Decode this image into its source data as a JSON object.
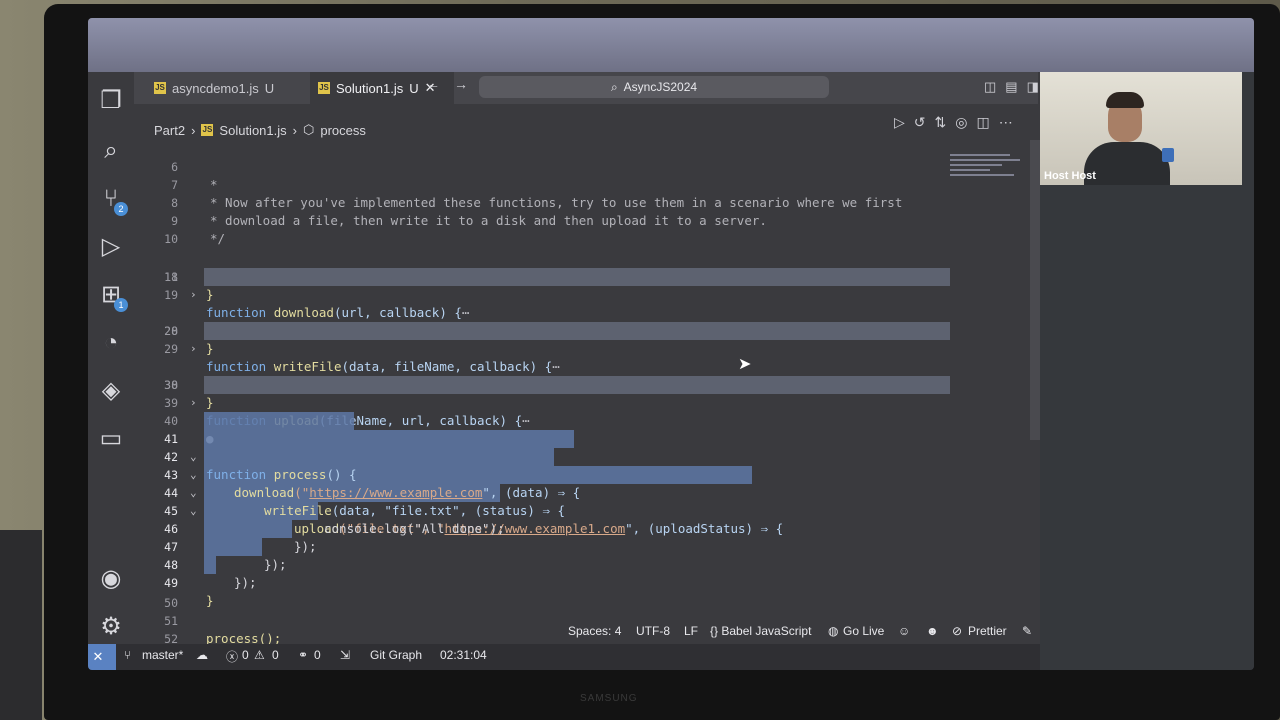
{
  "window": {
    "title": "AsyncJS2024"
  },
  "tabs": [
    {
      "label": "asyncdemo1.js",
      "status": "U"
    },
    {
      "label": "Solution1.js",
      "status": "U",
      "close": "✕"
    }
  ],
  "breadcrumb": {
    "folder": "Part2",
    "file": "Solution1.js",
    "symbol": "process"
  },
  "activity_badges": {
    "source_control": "2",
    "extensions": "1"
  },
  "code_lines": {
    "l6": {
      "num": "6",
      "text": "*"
    },
    "l7": {
      "num": "7",
      "text": "* Now after you've implemented these functions, try to use them in a scenario where we first"
    },
    "l8": {
      "num": "8",
      "text": "* download a file, then write it to a disk and then upload it to a server."
    },
    "l9": {
      "num": "9",
      "text": "*/"
    },
    "l10": {
      "num": "10"
    },
    "l11": {
      "num": "11",
      "kw": "function",
      "fn": "download",
      "params": "(url, callback) {",
      "ell": "⋯"
    },
    "l18": {
      "num": "18",
      "text": "}"
    },
    "l19": {
      "num": "19"
    },
    "l20": {
      "num": "20",
      "kw": "function",
      "fn": "writeFile",
      "params": "(data, fileName, callback) {",
      "ell": "⋯"
    },
    "l28": {
      "num": "28",
      "text": "}"
    },
    "l29": {
      "num": "29"
    },
    "l30": {
      "num": "30",
      "kw": "function",
      "fn": "upload",
      "params": "(fileName, url, callback) {",
      "ell": "⋯"
    },
    "l38": {
      "num": "38",
      "text": "}"
    },
    "l39": {
      "num": "39"
    },
    "l40": {
      "num": "40"
    },
    "l41": {
      "num": "41",
      "kw": "function",
      "fn": "process",
      "rest": "() {"
    },
    "l42": {
      "num": "42",
      "fn": "download",
      "open": "(\"",
      "url": "https://www.example.com",
      "rest": "\", (data) ⇒ {"
    },
    "l43": {
      "num": "43",
      "fn": "writeFile",
      "rest": "(data, \"file.txt\", (status) ⇒ {"
    },
    "l44": {
      "num": "44",
      "fn": "upload",
      "pre": "(\"file.txt\", \"",
      "url": "https://www.example1.com",
      "rest": "\", (uploadStatus) ⇒ {"
    },
    "l45": {
      "num": "45",
      "text": "console.log(\"All done\");"
    },
    "l46": {
      "num": "46",
      "text": "});"
    },
    "l47": {
      "num": "47",
      "text": "});"
    },
    "l48": {
      "num": "48",
      "text": "});"
    },
    "l49": {
      "num": "49",
      "text": "}"
    },
    "l50": {
      "num": "50"
    },
    "l51": {
      "num": "51",
      "text": "process();"
    },
    "l52": {
      "num": "52"
    }
  },
  "status": {
    "spaces": "Spaces: 4",
    "encoding": "UTF-8",
    "eol": "LF",
    "language": "{} Babel JavaScript",
    "golive": "Go Live",
    "prettier": "Prettier",
    "branch": "master*",
    "errors": "0",
    "warnings": "0",
    "ports": "0",
    "gitgraph": "Git Graph",
    "time": "02:31:04"
  },
  "video": {
    "label": "Host Host"
  },
  "monitor_brand": "SAMSUNG"
}
